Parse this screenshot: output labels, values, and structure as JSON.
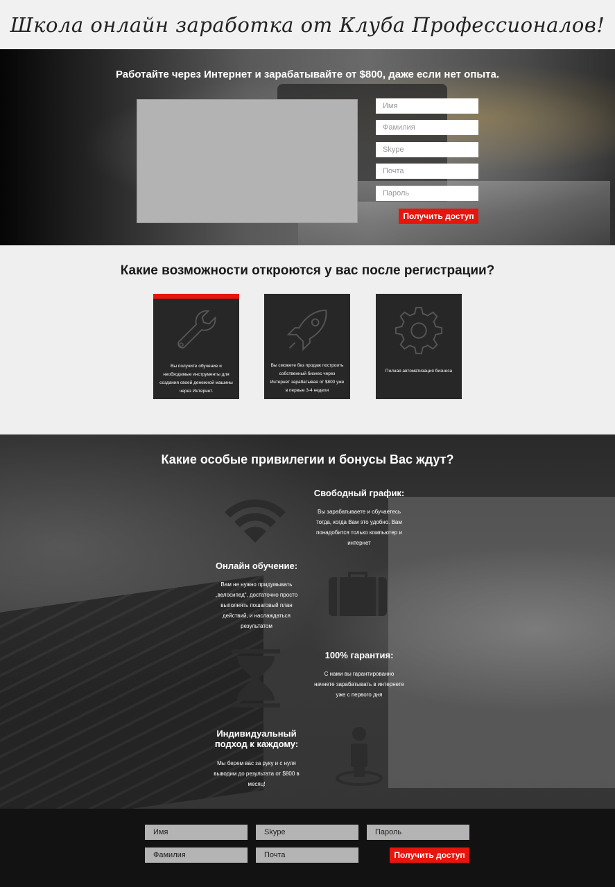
{
  "header": {
    "title": "Школа онлайн заработка от Клуба Профессионалов!"
  },
  "hero": {
    "heading": "Работайте через Интернет и зарабатывайте от $800, даже если нет опыта.",
    "form": {
      "first_name_placeholder": "Имя",
      "last_name_placeholder": "Фамилия",
      "skype_placeholder": "Skype",
      "email_placeholder": "Почта",
      "password_placeholder": "Пароль",
      "submit_label": "Получить доступ"
    }
  },
  "features": {
    "heading": "Какие возможности откроются у вас после регистрации?",
    "cards": [
      {
        "icon": "wrench-icon",
        "text": "Вы получите обучение и необходимые инструменты для создания своей денежной машины через Интернет."
      },
      {
        "icon": "rocket-icon",
        "text": "Вы сможете без продаж построить собственный бизнес через Интернет зарабатывая от $800 уже в первые 3-4 недели"
      },
      {
        "icon": "gear-icon",
        "text": "Полная автоматизация бизнеса"
      }
    ],
    "accent_color": "#e8150d"
  },
  "bonuses": {
    "heading": "Какие особые привилегии и бонусы Вас ждут?",
    "items": [
      {
        "icon": "wifi-icon",
        "title": "Свободный график:",
        "text": "Вы зарабатываете и обучаетесь тогда, когда Вам это удобно. Вам понадобится только компьютер и интернет"
      },
      {
        "icon": "briefcase-icon",
        "title": "Онлайн обучение:",
        "text": "Вам не нужно придумывать „велосипед“, достаточно просто выполнять пошаговый план действий, и наслаждаться результатом"
      },
      {
        "icon": "hourglass-icon",
        "title": "100% гарантия:",
        "text": "С нами вы гарантированно начнете зарабатывать в интернете уже с первого дня"
      },
      {
        "icon": "person-icon",
        "title": "Индивидуальный подход к каждому:",
        "text": "Мы берем вас за руку и с нуля выводим до результата от $800 в месяц!"
      }
    ]
  },
  "footer_form": {
    "first_name_placeholder": "Имя",
    "skype_placeholder": "Skype",
    "password_placeholder": "Пароль",
    "last_name_placeholder": "Фамилия",
    "email_placeholder": "Почта",
    "submit_label": "Получить доступ"
  }
}
